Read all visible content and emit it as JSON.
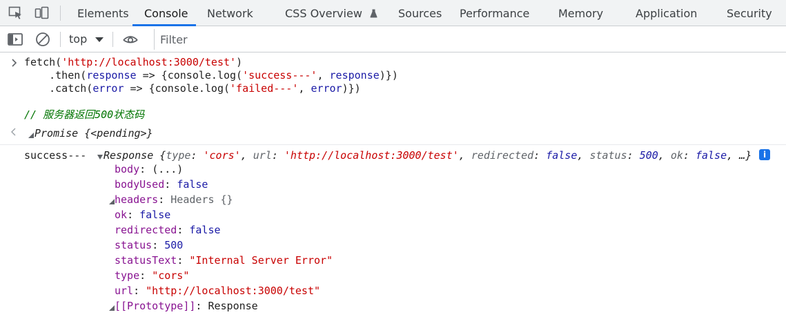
{
  "tabs": [
    {
      "label": "Elements",
      "active": false
    },
    {
      "label": "Console",
      "active": true
    },
    {
      "label": "Network",
      "active": false
    },
    {
      "label": "CSS Overview",
      "active": false,
      "icon": "flask-icon"
    },
    {
      "label": "Sources",
      "active": false
    },
    {
      "label": "Performance",
      "active": false
    },
    {
      "label": "Memory",
      "active": false
    },
    {
      "label": "Application",
      "active": false
    },
    {
      "label": "Security",
      "active": false
    }
  ],
  "toolbar": {
    "context": "top",
    "filter_placeholder": "Filter"
  },
  "colors": {
    "accent": "#1a73e8",
    "string": "#c80000",
    "keyword": "#1a1aa6",
    "key": "#881391",
    "comment": "#007400"
  },
  "console": {
    "input": {
      "line1": [
        "fetch(",
        "'http://localhost:3000/test'",
        ")"
      ],
      "line2": [
        "    .then(",
        "response",
        " => {console.log(",
        "'success---'",
        ", ",
        "response",
        ")})"
      ],
      "line3": [
        "    .catch(",
        "error",
        " => {console.log(",
        "'failed---'",
        ", ",
        "error",
        ")})"
      ],
      "comment": "// 服务器返回500状态码"
    },
    "result": {
      "text": "Promise {<pending>}"
    },
    "log": {
      "prefix": "success---",
      "summary": {
        "class": "Response",
        "open": " {",
        "k_type": "type",
        "v_type": "'cors'",
        "k_url": "url",
        "v_url": "'http://localhost:3000/test'",
        "k_redirected": "redirected",
        "v_redirected": "false",
        "k_status": "status",
        "v_status": "500",
        "k_ok": "ok",
        "v_ok": "false",
        "tail": ", …}"
      },
      "properties": [
        {
          "key": "body",
          "value": "(...)",
          "kind": "plain",
          "expandable": false
        },
        {
          "key": "bodyUsed",
          "value": "false",
          "kind": "kw",
          "expandable": false
        },
        {
          "key": "headers",
          "value": "Headers {}",
          "kind": "sub",
          "expandable": true
        },
        {
          "key": "ok",
          "value": "false",
          "kind": "kw",
          "expandable": false
        },
        {
          "key": "redirected",
          "value": "false",
          "kind": "kw",
          "expandable": false
        },
        {
          "key": "status",
          "value": "500",
          "kind": "kw",
          "expandable": false
        },
        {
          "key": "statusText",
          "value": "\"Internal Server Error\"",
          "kind": "str",
          "expandable": false
        },
        {
          "key": "type",
          "value": "\"cors\"",
          "kind": "str",
          "expandable": false
        },
        {
          "key": "url",
          "value": "\"http://localhost:3000/test\"",
          "kind": "str",
          "expandable": false
        },
        {
          "key": "[[Prototype]]",
          "value": "Response",
          "kind": "plain",
          "expandable": true
        }
      ]
    }
  }
}
